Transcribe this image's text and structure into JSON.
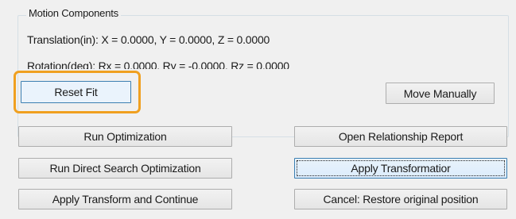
{
  "motion_components": {
    "title": "Motion Components",
    "translation_text": "Translation(in):  X = 0.0000,  Y = 0.0000,  Z = 0.0000",
    "rotation_text": "Rotation(deg):  Rx = 0.0000,  Ry = -0.0000,  Rz = 0.0000",
    "reset_fit_label": "Reset Fit",
    "move_manually_label": "Move Manually"
  },
  "actions": {
    "run_optimization": "Run Optimization",
    "open_relationship_report": "Open Relationship Report",
    "run_direct_search_optimization": "Run Direct Search Optimization",
    "apply_transformation": "Apply Transformatior",
    "apply_transform_and_continue": "Apply Transform and Continue",
    "cancel_restore": "Cancel: Restore original position"
  },
  "colors": {
    "highlight": "#f0a020",
    "focused_border": "#3c7fb1"
  }
}
